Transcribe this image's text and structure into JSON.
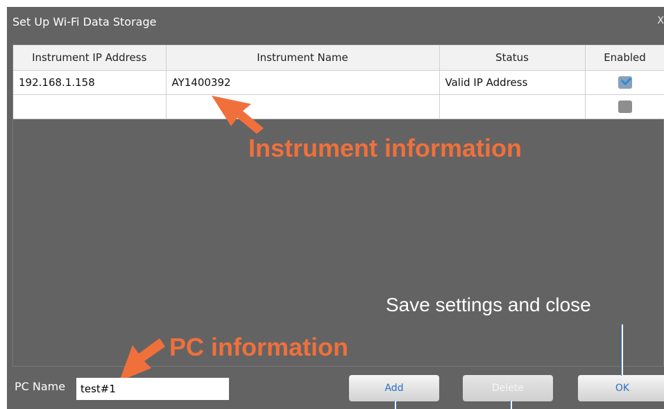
{
  "window": {
    "title": "Set Up Wi-Fi Data Storage",
    "close_glyph": "X"
  },
  "table": {
    "columns": [
      "Instrument IP Address",
      "Instrument Name",
      "Status",
      "Enabled"
    ],
    "rows": [
      {
        "ip": "192.168.1.158",
        "name": "AY1400392",
        "status": "Valid IP Address",
        "enabled": true
      },
      {
        "ip": "",
        "name": "",
        "status": "",
        "enabled": false
      }
    ]
  },
  "annotations": {
    "instrument": "Instrument information",
    "pc": "PC information",
    "save": "Save settings and close"
  },
  "pc": {
    "label": "PC  Name",
    "value": "test#1"
  },
  "buttons": {
    "add": "Add",
    "delete": "Delete",
    "ok": "OK"
  },
  "colors": {
    "accent": "#f0703c",
    "dialog_bg": "#636363",
    "button_text": "#2a6fc4"
  }
}
